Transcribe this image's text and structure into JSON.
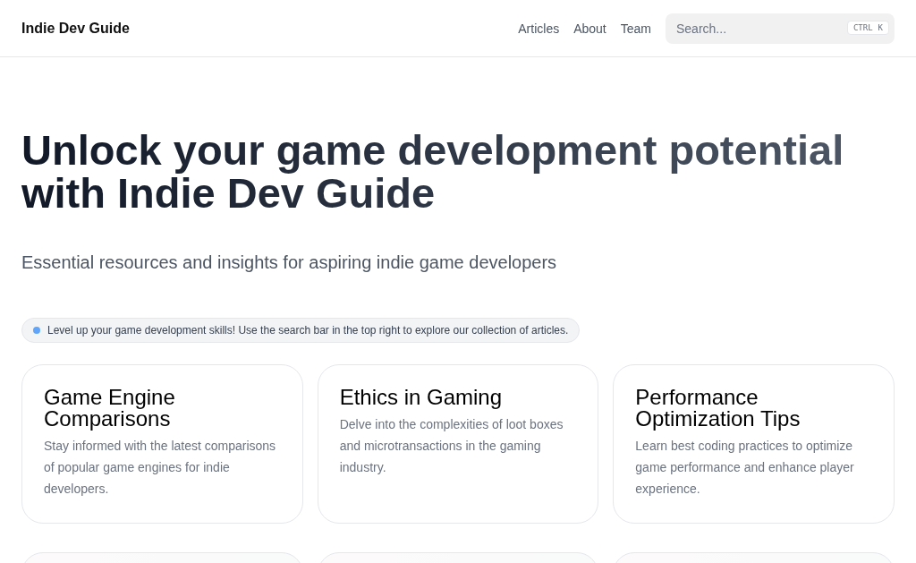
{
  "header": {
    "logo": "Indie Dev Guide",
    "nav": [
      "Articles",
      "About",
      "Team"
    ],
    "search": {
      "placeholder": "Search...",
      "shortcut": [
        "CTRL",
        "K"
      ]
    }
  },
  "hero": {
    "title_lines": [
      "Unlock your game development potential",
      "with Indie Dev Guide"
    ],
    "subtitle": "Essential resources and insights for aspiring indie game developers"
  },
  "notice": {
    "text": "Level up your game development skills! Use the search bar in the top right to explore our collection of articles.",
    "color": "#60a5fa"
  },
  "cards": [
    {
      "title": "Game Engine Comparisons",
      "description": "Stay informed with the latest comparisons of popular game engines for indie developers."
    },
    {
      "title": "Ethics in Gaming",
      "description": "Delve into the complexities of loot boxes and microtransactions in the gaming industry."
    },
    {
      "title": "Performance Optimization Tips",
      "description": "Learn best coding practices to optimize game performance and enhance player experience."
    }
  ]
}
